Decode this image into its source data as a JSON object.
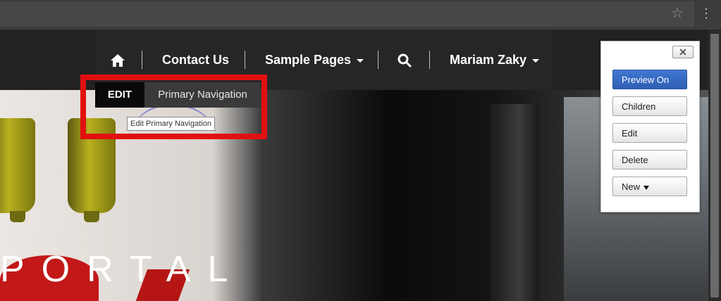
{
  "navbar": {
    "home_icon": "home-icon",
    "contact": "Contact Us",
    "sample_pages": "Sample Pages",
    "search_icon": "search-icon",
    "user": "Mariam Zaky"
  },
  "edit_bar": {
    "edit_label": "EDIT",
    "primary_nav_label": "Primary Navigation",
    "tooltip": "Edit Primary Navigation"
  },
  "hero": {
    "text": "PORTAL"
  },
  "admin_panel": {
    "close_label": "✕",
    "preview_on": "Preview On",
    "children": "Children",
    "edit": "Edit",
    "delete": "Delete",
    "new": "New"
  },
  "browser": {
    "star_icon": "star-icon",
    "menu_icon": "kebab-menu-icon"
  },
  "colors": {
    "highlight": "#e11010",
    "primary_button": "#3469c6",
    "navbar": "#222222"
  }
}
